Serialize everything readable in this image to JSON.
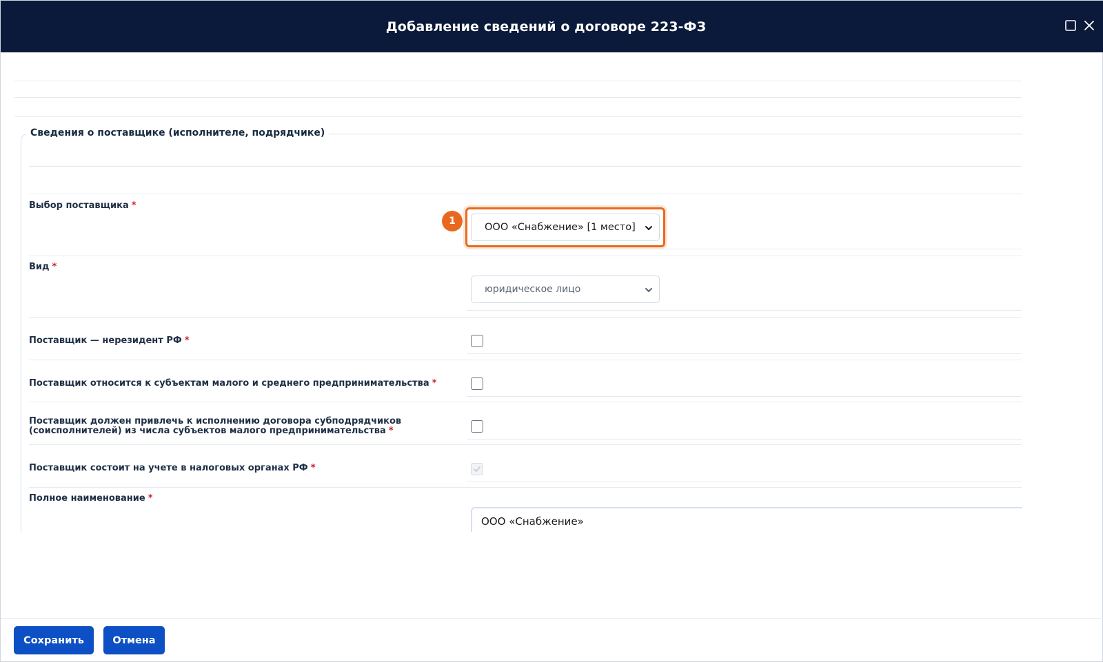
{
  "window": {
    "title": "Добавление сведений о договоре 223-ФЗ"
  },
  "section": {
    "legend": "Сведения о поставщике (исполнителе, подрядчике)"
  },
  "fields": {
    "supplier_choice": {
      "label": "Выбор поставщика",
      "value": "ООО «Снабжение» [1 место]"
    },
    "kind": {
      "label": "Вид",
      "value": "юридическое лицо"
    },
    "non_resident": {
      "label": "Поставщик — нерезидент РФ",
      "checked": false
    },
    "sme": {
      "label": "Поставщик относится к субъектам малого и среднего предпринимательства",
      "checked": false
    },
    "subcontractors": {
      "label_line1": "Поставщик должен привлечь к исполнению договора субподрядчиков",
      "label_line2": "(соисполнителей) из числа субъектов малого предпринимательства",
      "checked": false
    },
    "tax_registered": {
      "label": "Поставщик состоит на учете в налоговых органах РФ",
      "checked": true,
      "disabled": true
    },
    "full_name": {
      "label": "Полное наименование",
      "value": "ООО «Снабжение»"
    }
  },
  "required_mark": "*",
  "callout": {
    "number": "1",
    "color": "#e8691e"
  },
  "buttons": {
    "save": "Сохранить",
    "cancel": "Отмена"
  },
  "colors": {
    "header_bg": "#0b1a3a",
    "primary": "#0d4fc4",
    "required": "#d0202a"
  }
}
